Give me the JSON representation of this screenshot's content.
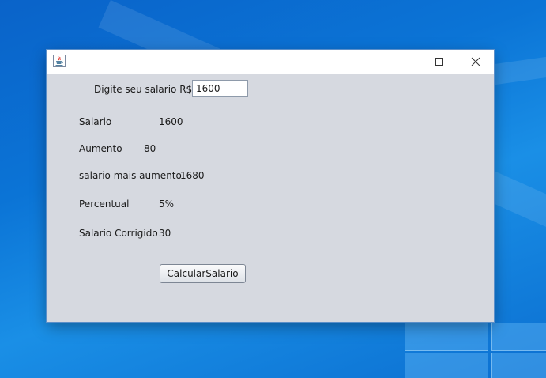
{
  "window": {
    "title": "",
    "minimize_icon": "minimize-icon",
    "maximize_icon": "maximize-icon",
    "close_icon": "close-icon",
    "app_icon": "java-cup-icon"
  },
  "form": {
    "prompt_label": "Digite seu salario R$",
    "salary_input_value": "1600",
    "rows": [
      {
        "label": "Salario",
        "value": "1600"
      },
      {
        "label": "Aumento",
        "value": "80"
      },
      {
        "label": "salario mais aumento",
        "value": "1680"
      },
      {
        "label": "Percentual",
        "value": "5%"
      },
      {
        "label": "Salario Corrigido",
        "value": "30"
      }
    ],
    "calc_button_label": "CalcularSalario"
  },
  "colors": {
    "desktop_blue": "#0b74d6",
    "window_bg": "#d6d9e0",
    "titlebar_bg": "#ffffff"
  }
}
